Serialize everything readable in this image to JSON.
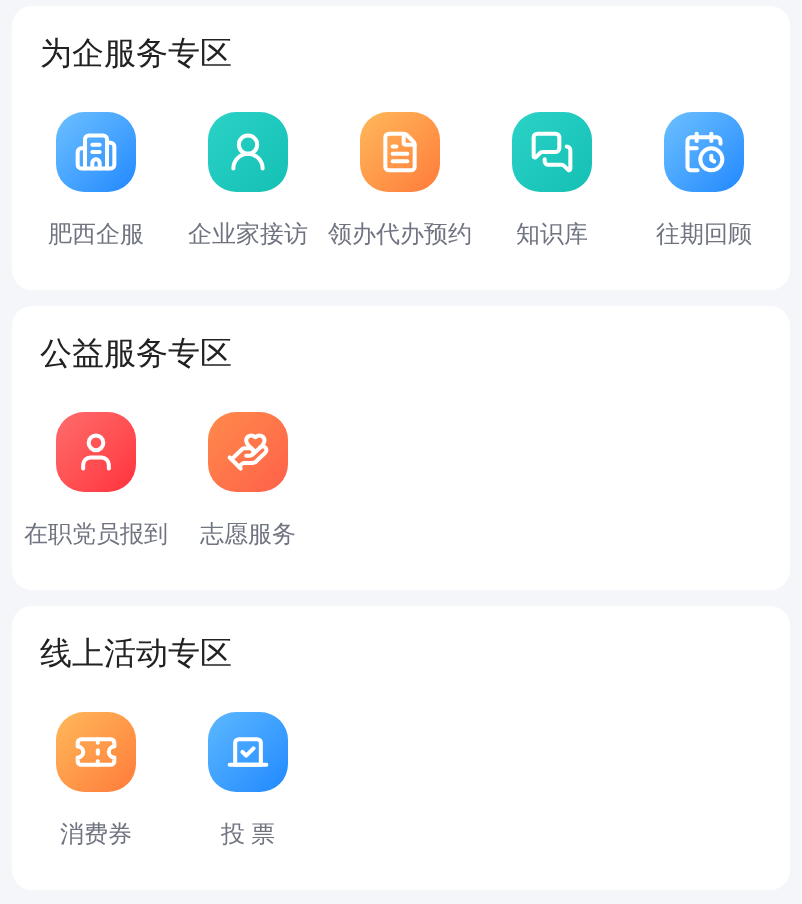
{
  "sections": [
    {
      "title": "为企服务专区",
      "items": [
        {
          "label": "肥西企服",
          "kind": "building"
        },
        {
          "label": "企业家接访",
          "kind": "visitor"
        },
        {
          "label": "领办代办预约",
          "kind": "form"
        },
        {
          "label": "知识库",
          "kind": "qa"
        },
        {
          "label": "往期回顾",
          "kind": "history"
        }
      ]
    },
    {
      "title": "公益服务专区",
      "items": [
        {
          "label": "在职党员报到",
          "kind": "member"
        },
        {
          "label": "志愿服务",
          "kind": "volunteer"
        }
      ]
    },
    {
      "title": "线上活动专区",
      "items": [
        {
          "label": "消费券",
          "kind": "coupon"
        },
        {
          "label": "投 票",
          "kind": "vote"
        }
      ]
    }
  ]
}
